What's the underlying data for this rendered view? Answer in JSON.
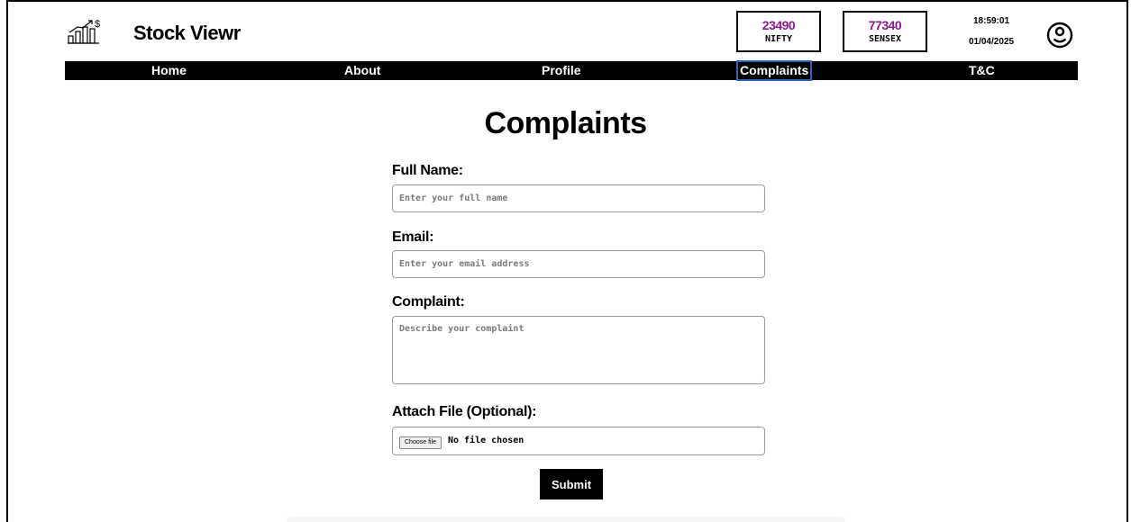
{
  "brand": {
    "name": "Stock Viewr",
    "logo_icon": "stock-chart-dollar-icon"
  },
  "tickers": [
    {
      "value": "23490",
      "label": "NIFTY"
    },
    {
      "value": "77340",
      "label": "SENSEX"
    }
  ],
  "clock": {
    "time": "18:59:01",
    "date": "01/04/2025"
  },
  "profile": {
    "icon": "user-profile-icon"
  },
  "nav": {
    "items": [
      {
        "label": "Home"
      },
      {
        "label": "About"
      },
      {
        "label": "Profile"
      },
      {
        "label": "Complaints"
      },
      {
        "label": "T&C"
      }
    ],
    "active": "Complaints"
  },
  "form": {
    "title": "Complaints",
    "full_name": {
      "label": "Full Name:",
      "placeholder": "Enter your full name"
    },
    "email": {
      "label": "Email:",
      "placeholder": "Enter your email address"
    },
    "complaint": {
      "label": "Complaint:",
      "placeholder": "Describe your complaint"
    },
    "attachment": {
      "label": "Attach File (Optional):",
      "button_label": "Choose file",
      "status": "No file chosen"
    },
    "submit_label": "Submit"
  },
  "colors": {
    "ticker_value": "#8a1a8f",
    "nav_bg": "#000000",
    "active_outline": "#2d62c4"
  }
}
